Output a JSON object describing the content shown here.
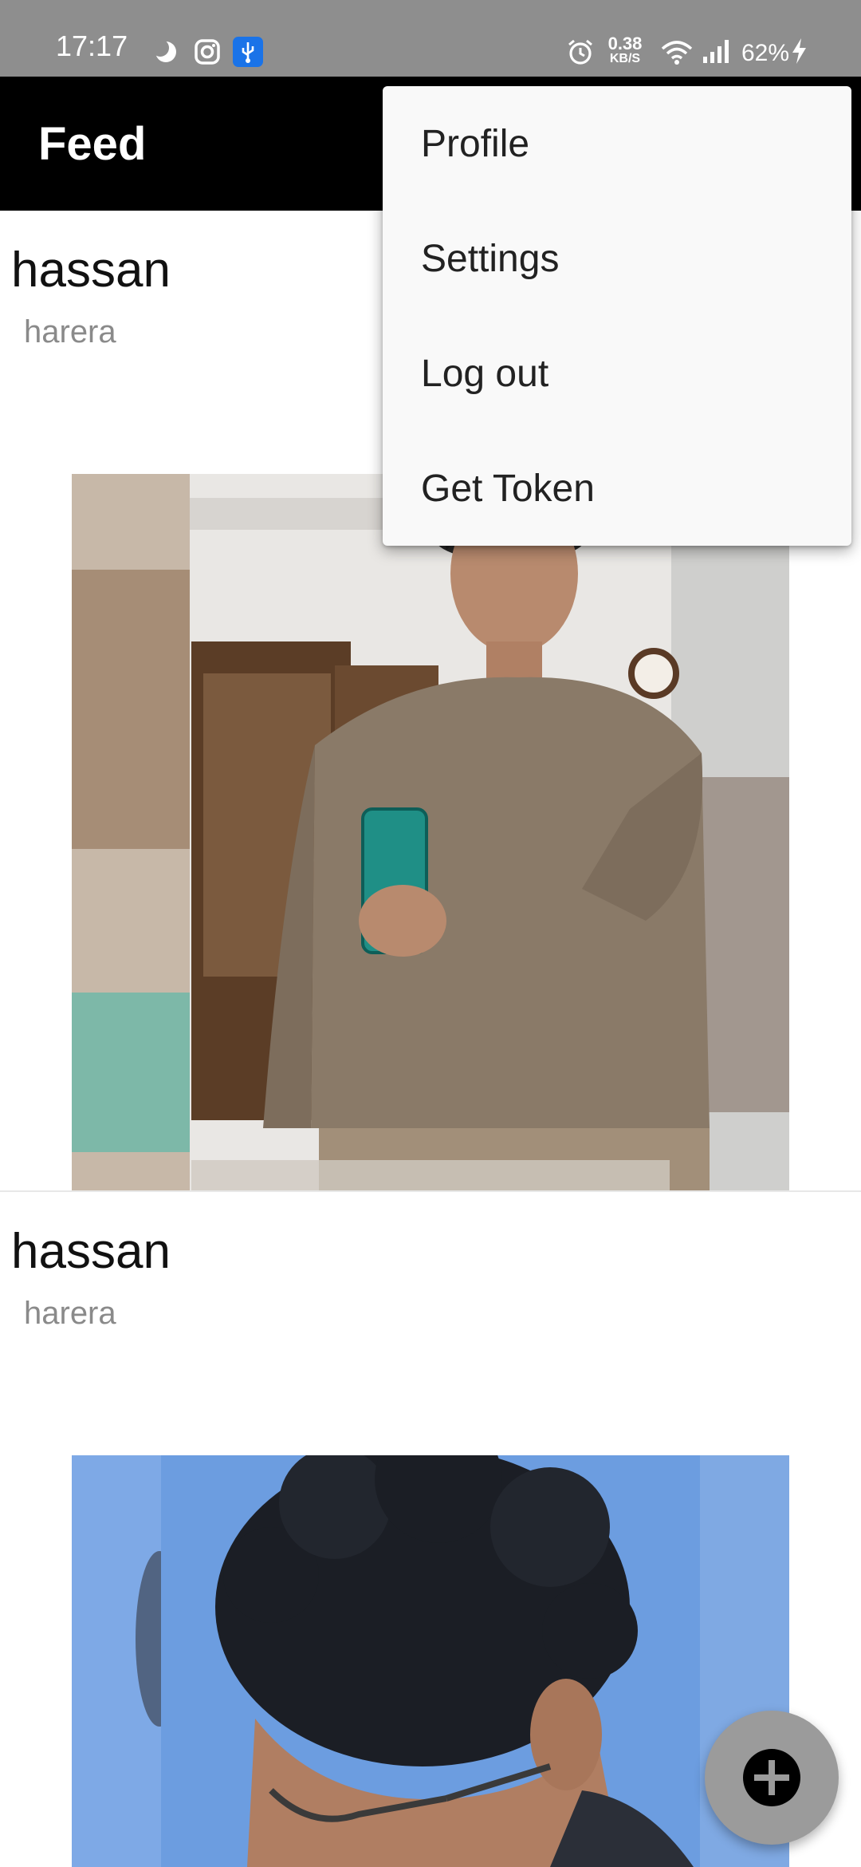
{
  "status_bar": {
    "time": "17:17",
    "network_speed_value": "0.38",
    "network_speed_unit": "KB/S",
    "battery": "62%",
    "icons": [
      "moon-icon",
      "instagram-icon",
      "usb-icon",
      "alarm-icon",
      "wifi-icon",
      "signal-icon",
      "charging-icon"
    ]
  },
  "app_bar": {
    "title": "Feed"
  },
  "menu": {
    "items": [
      {
        "label": "Profile"
      },
      {
        "label": "Settings"
      },
      {
        "label": "Log out"
      },
      {
        "label": "Get Token"
      }
    ]
  },
  "feed": {
    "posts": [
      {
        "username": "hassan",
        "caption": "harera"
      },
      {
        "username": "hassan",
        "caption": "harera"
      }
    ]
  },
  "fab": {
    "icon": "add-icon"
  },
  "colors": {
    "status_bar_bg": "#8e8e8e",
    "app_bar_bg": "#000000",
    "menu_bg": "#f9f9f9",
    "fab_bg": "#9b9b9b",
    "caption_text": "#8a8a8a"
  }
}
